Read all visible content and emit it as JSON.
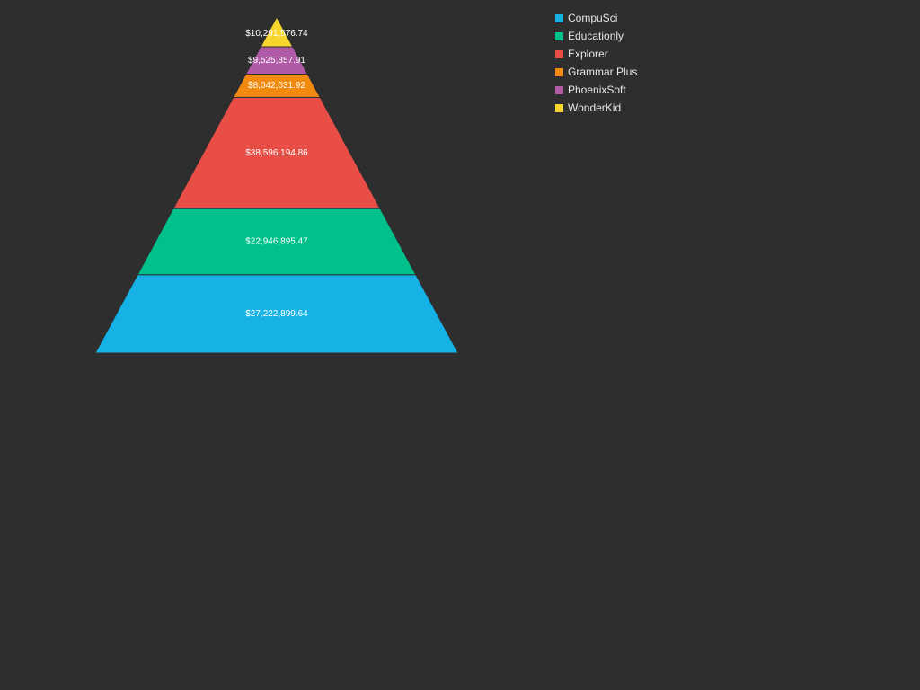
{
  "chart_data": {
    "type": "pyramid",
    "title": "",
    "legend_position": "top-right",
    "grid": false,
    "segments": [
      {
        "name": "CompuSci",
        "value": 27222899.64,
        "label": "$27,222,899.64",
        "color": "#16b2e6"
      },
      {
        "name": "Educationly",
        "value": 22946895.47,
        "label": "$22,946,895.47",
        "color": "#00c08b"
      },
      {
        "name": "Explorer",
        "value": 38596194.86,
        "label": "$38,596,194.86",
        "color": "#e84e45"
      },
      {
        "name": "Grammar Plus",
        "value": 8042031.92,
        "label": "$8,042,031.92",
        "color": "#f18a0e"
      },
      {
        "name": "PhoenixSoft",
        "value": 9525857.91,
        "label": "$9,525,857.91",
        "color": "#b05aa8"
      },
      {
        "name": "WonderKid",
        "value": 10291576.74,
        "label": "$10,291,576.74",
        "color": "#f7d52d"
      }
    ]
  }
}
